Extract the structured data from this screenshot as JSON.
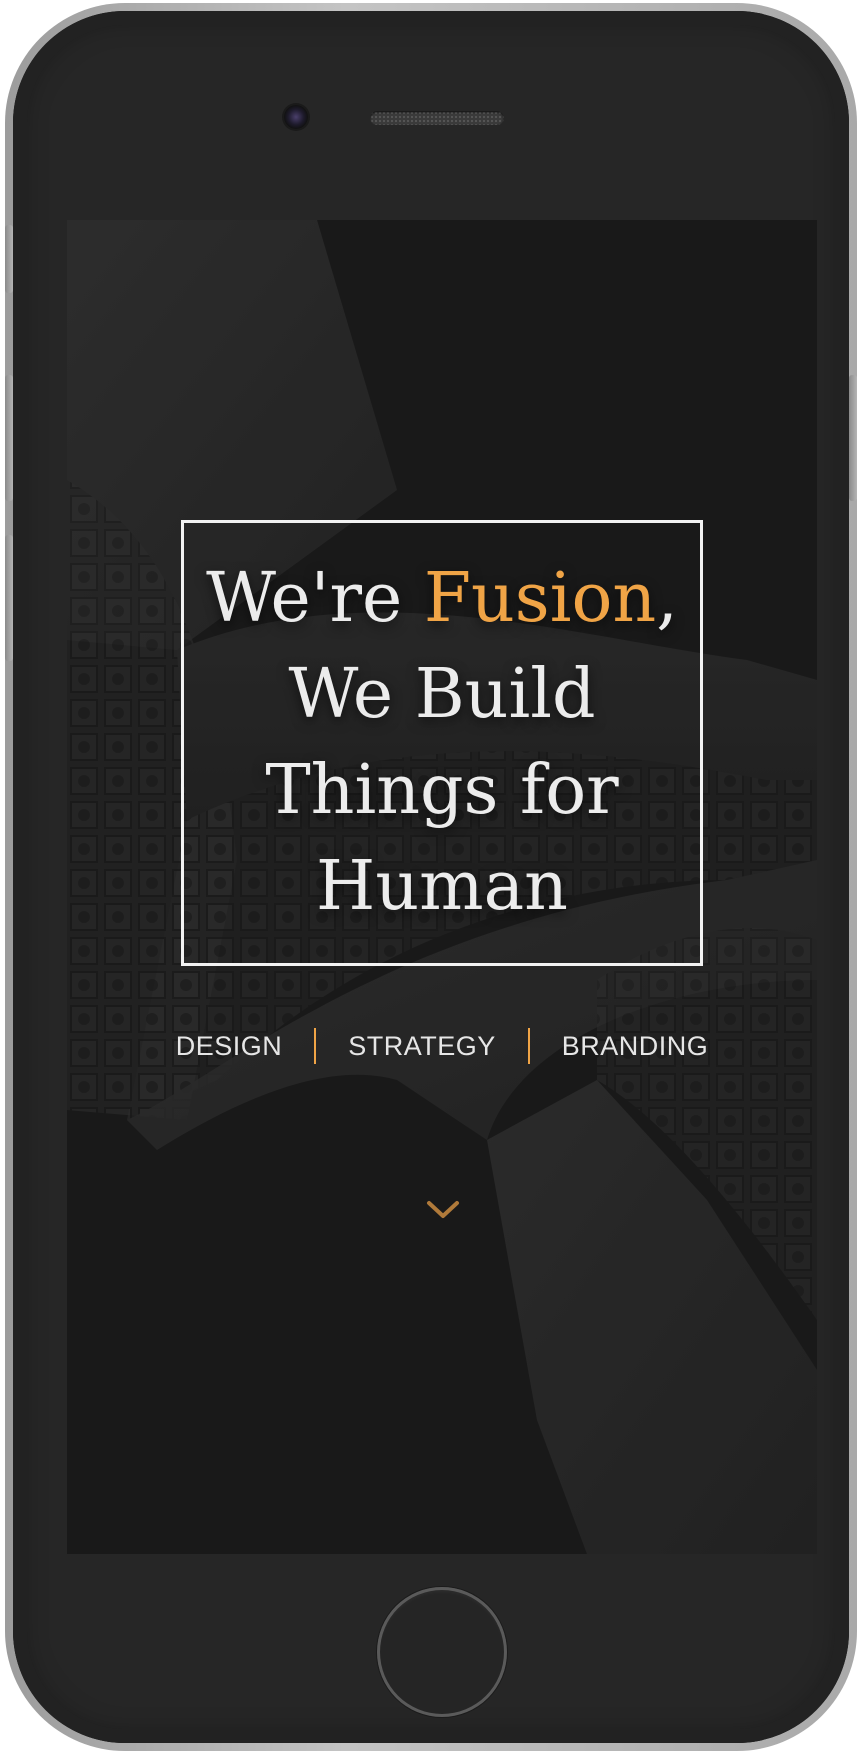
{
  "hero": {
    "title_prefix": "We're ",
    "title_accent": "Fusion",
    "title_comma": ",",
    "title_line2": "We Build",
    "title_line3": "Things for",
    "title_line4": "Human"
  },
  "tags": [
    "DESIGN",
    "STRATEGY",
    "BRANDING"
  ],
  "icons": {
    "scroll": "chevron-down-icon",
    "camera": "camera-icon",
    "speaker": "speaker-grille",
    "home": "home-button"
  },
  "colors": {
    "accent": "#f0a446",
    "text": "#ececec",
    "background": "#1d1d1d",
    "device_body": "#262626"
  }
}
